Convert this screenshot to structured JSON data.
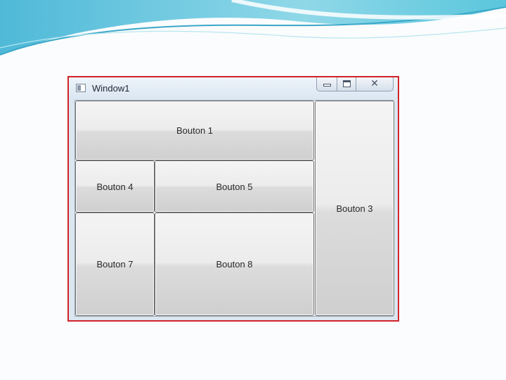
{
  "window": {
    "title": "Window1",
    "icon": "window-icon",
    "caption_buttons": [
      "minimize-icon",
      "maximize-icon",
      "close-icon"
    ]
  },
  "buttons": {
    "b1": "Bouton 1",
    "b3": "Bouton 3",
    "b4": "Bouton 4",
    "b5": "Bouton 5",
    "b7": "Bouton 7",
    "b8": "Bouton 8"
  },
  "colors": {
    "highlight_border": "#d2232a",
    "banner_accent": "#5cc6dc"
  }
}
